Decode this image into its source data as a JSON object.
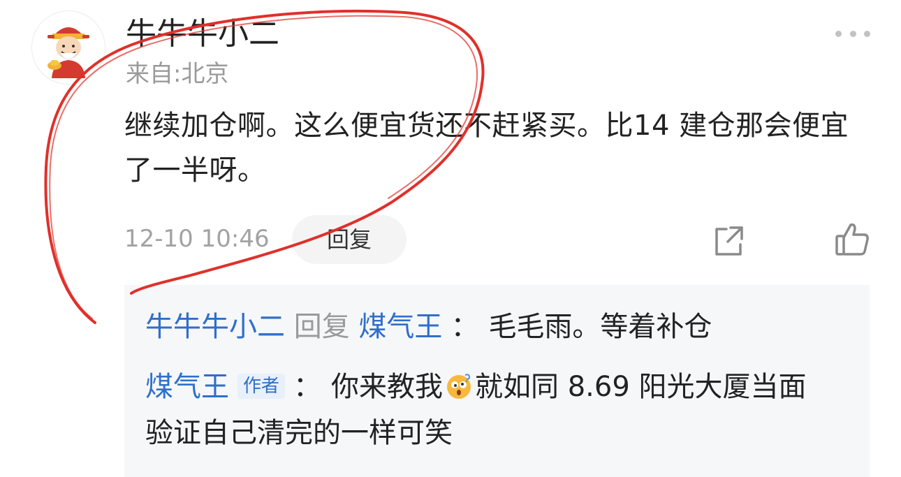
{
  "comment": {
    "author": "牛牛牛小二",
    "location": "来自:北京",
    "text": "继续加仓啊。这么便宜货还不赶紧买。比14 建仓那会便宜了一半呀。",
    "timestamp": "12-10 10:46",
    "reply_label": "回复",
    "icons": {
      "more": "more-icon",
      "share": "share-icon",
      "like": "thumbs-up-icon",
      "avatar": "avatar-god-of-wealth"
    }
  },
  "replies": [
    {
      "from": "牛牛牛小二",
      "reply_word": "回复",
      "to": "煤气王",
      "colon": "：",
      "text": "毛毛雨。等着补仓"
    },
    {
      "from": "煤气王",
      "badge": "作者",
      "colon": "：",
      "text_before_emoji": "你来教我",
      "emoji": "dizzy-face-emoji",
      "text_after_emoji": "就如同 8.69 阳光大厦当面",
      "text_line_2": "验证自己清完的一样可笑"
    }
  ],
  "colors": {
    "link_blue": "#2f6fc9",
    "annotation_red": "#e0302a",
    "reply_bg": "#f6f7f9",
    "muted_gray": "#9a9a9a"
  }
}
